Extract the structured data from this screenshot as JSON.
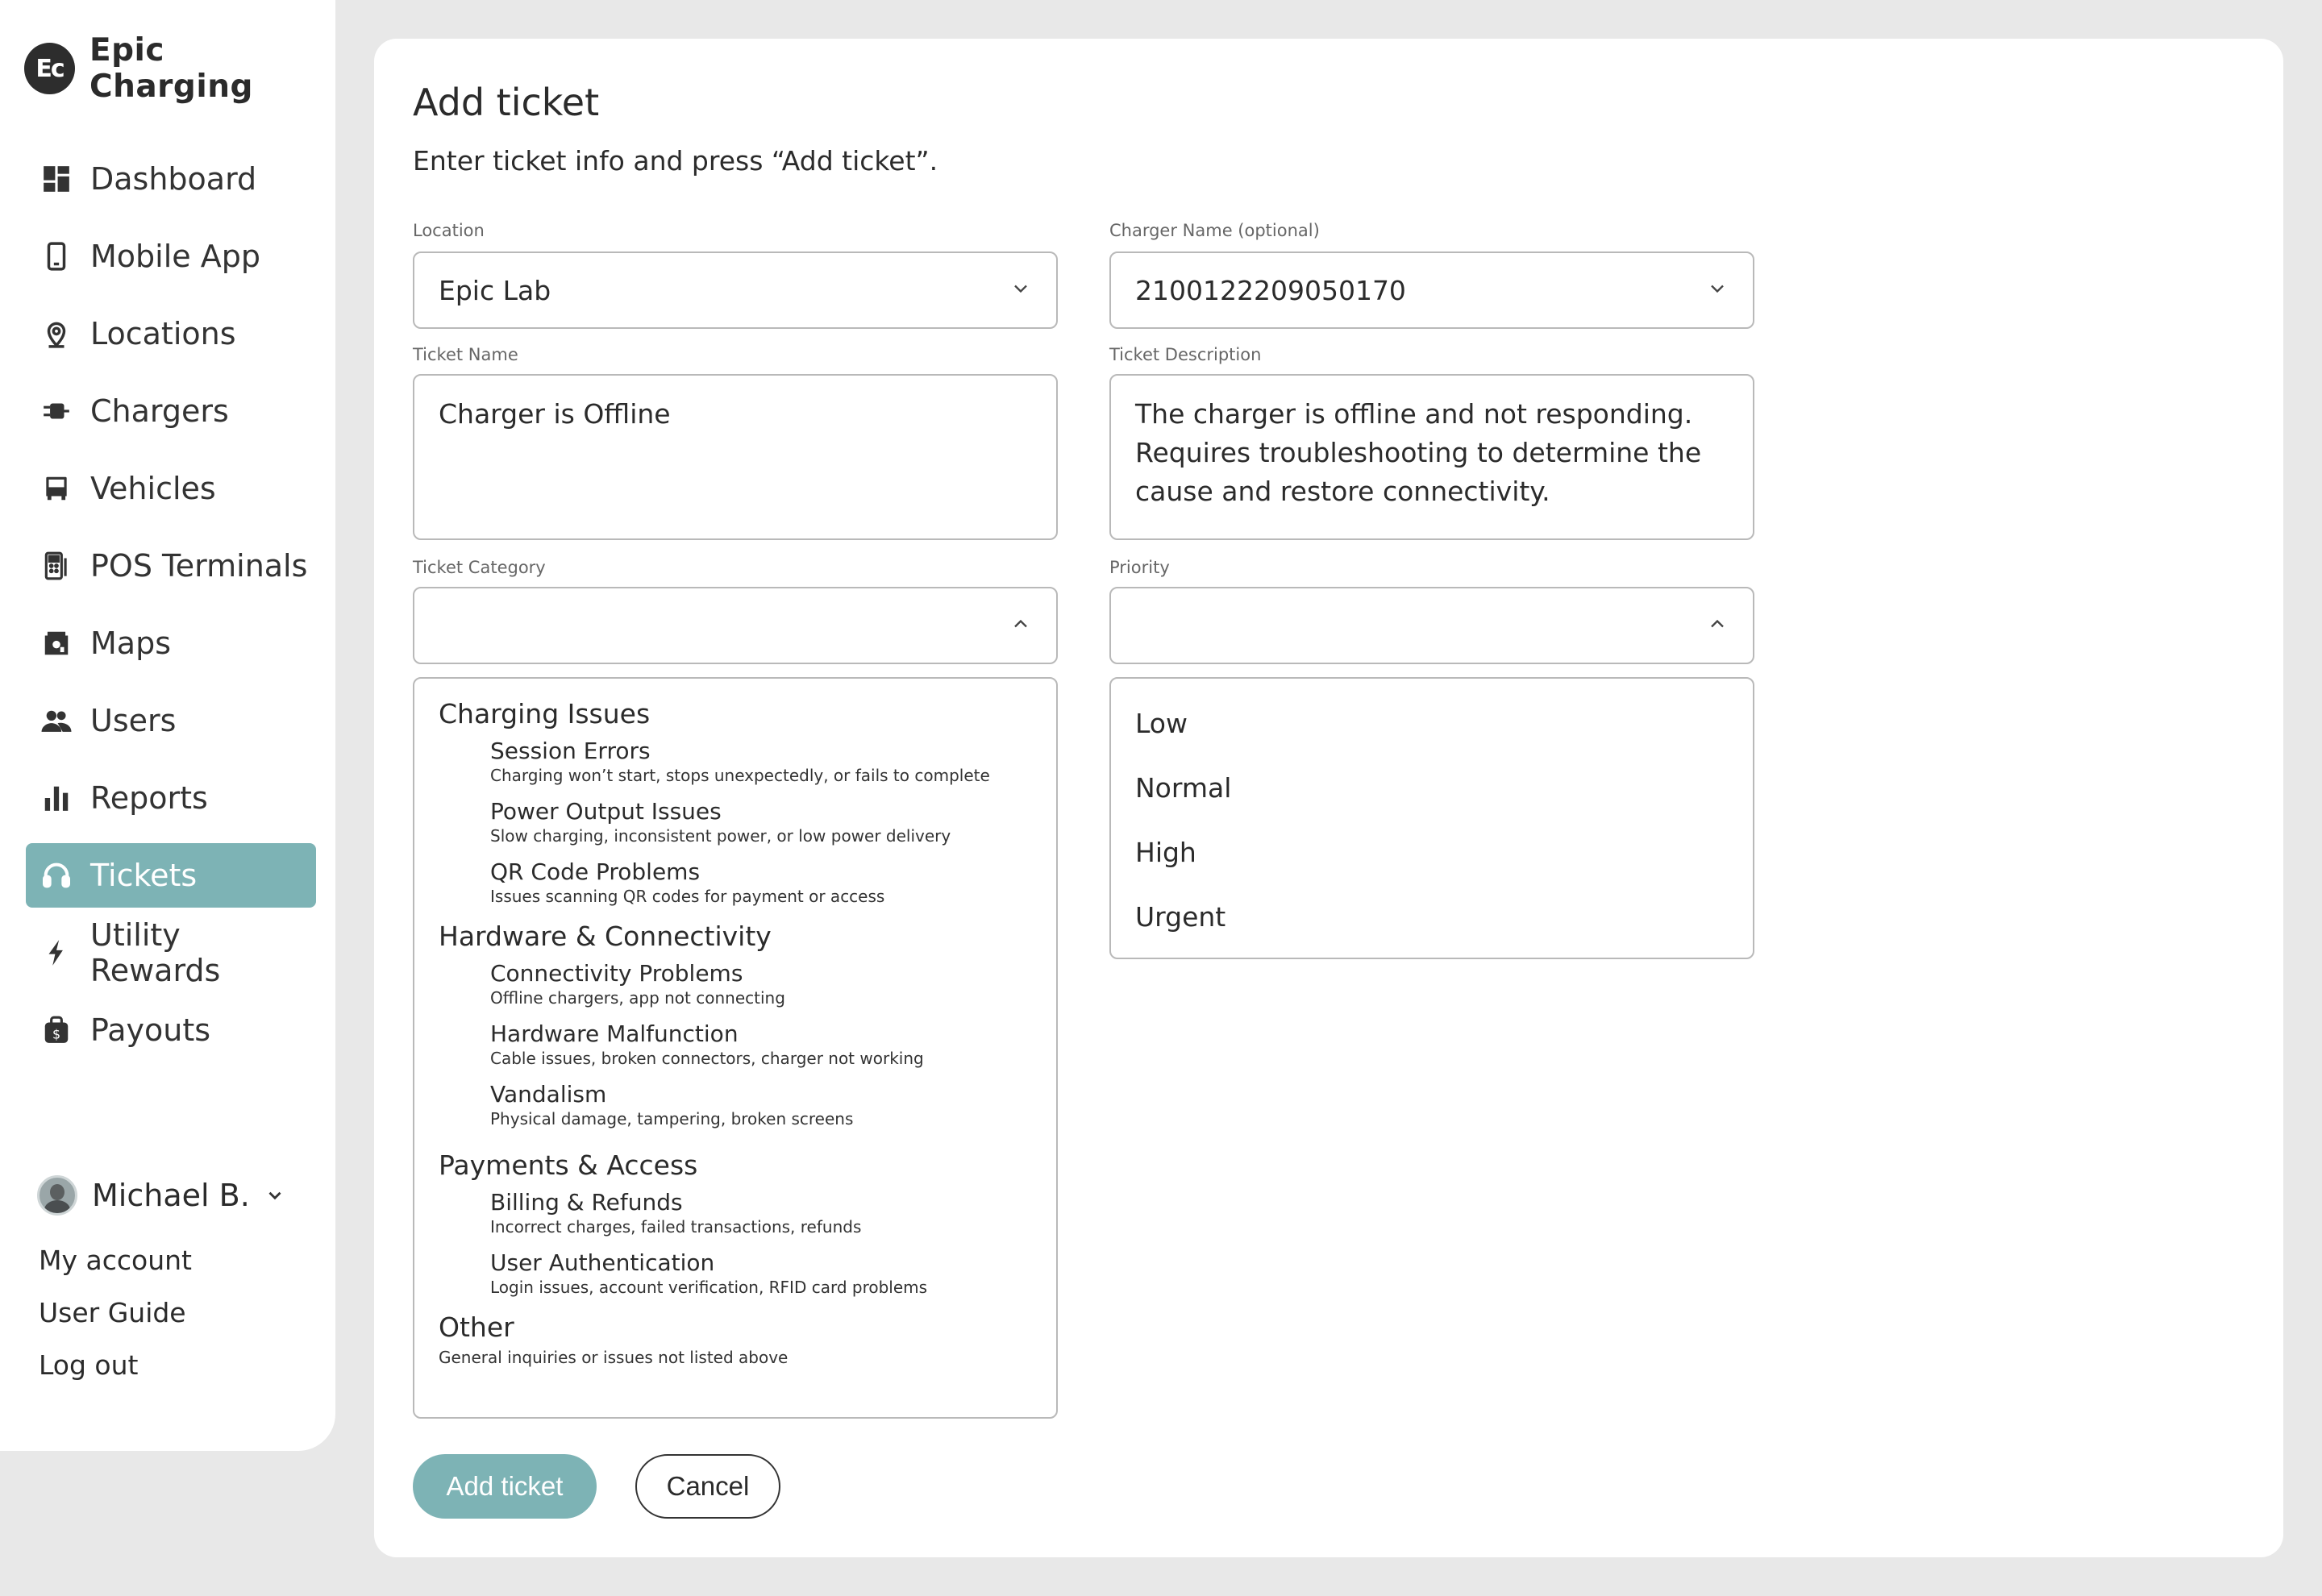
{
  "brand": {
    "logo_text": "Ec",
    "name": "Epic Charging"
  },
  "nav": [
    {
      "label": "Dashboard",
      "icon": "dashboard-icon"
    },
    {
      "label": "Mobile App",
      "icon": "mobile-icon"
    },
    {
      "label": "Locations",
      "icon": "location-pin-icon"
    },
    {
      "label": "Chargers",
      "icon": "charger-plug-icon"
    },
    {
      "label": "Vehicles",
      "icon": "bus-icon"
    },
    {
      "label": "POS Terminals",
      "icon": "pos-terminal-icon"
    },
    {
      "label": "Maps",
      "icon": "map-icon"
    },
    {
      "label": "Users",
      "icon": "users-icon"
    },
    {
      "label": "Reports",
      "icon": "bar-chart-icon"
    },
    {
      "label": "Tickets",
      "icon": "headset-icon",
      "active": true
    },
    {
      "label": "Utility Rewards",
      "icon": "bolt-icon"
    },
    {
      "label": "Payouts",
      "icon": "money-bag-icon"
    }
  ],
  "user": {
    "name": "Michael B.",
    "links": [
      "My account",
      "User Guide",
      "Log out"
    ]
  },
  "form": {
    "title": "Add ticket",
    "subtitle": "Enter ticket info and press “Add ticket”.",
    "location": {
      "label": "Location",
      "value": "Epic Lab"
    },
    "charger": {
      "label": "Charger Name (optional)",
      "value": "2100122209050170"
    },
    "ticket_name": {
      "label": "Ticket Name",
      "value": "Charger is Offline"
    },
    "ticket_description": {
      "label": "Ticket Description",
      "value": "The charger is offline and not responding. Requires troubleshooting to determine the cause and restore connectivity."
    },
    "category": {
      "label": "Ticket Category",
      "value": ""
    },
    "priority": {
      "label": "Priority",
      "value": ""
    }
  },
  "categories": [
    {
      "group": "Charging Issues",
      "items": [
        {
          "name": "Session Errors",
          "desc": "Charging won’t start, stops unexpectedly, or fails to complete"
        },
        {
          "name": "Power Output Issues",
          "desc": "Slow charging, inconsistent power, or low power delivery"
        },
        {
          "name": "QR Code Problems",
          "desc": "Issues scanning QR codes for payment or access"
        }
      ]
    },
    {
      "group": "Hardware & Connectivity",
      "items": [
        {
          "name": "Connectivity Problems",
          "desc": "Offline chargers, app not connecting"
        },
        {
          "name": "Hardware Malfunction",
          "desc": "Cable issues, broken connectors, charger not working"
        },
        {
          "name": "Vandalism",
          "desc": "Physical damage, tampering, broken screens"
        }
      ]
    },
    {
      "group": "Payments & Access",
      "items": [
        {
          "name": "Billing & Refunds",
          "desc": "Incorrect charges, failed transactions, refunds"
        },
        {
          "name": "User Authentication",
          "desc": "Login issues, account verification, RFID card problems"
        }
      ]
    }
  ],
  "other": {
    "group": "Other",
    "desc": "General inquiries or issues not listed above"
  },
  "priorities": [
    "Low",
    "Normal",
    "High",
    "Urgent"
  ],
  "buttons": {
    "add": "Add ticket",
    "cancel": "Cancel"
  },
  "colors": {
    "accent": "#7db3b5",
    "background": "#e8e8e8",
    "text": "#2b2b2b"
  }
}
